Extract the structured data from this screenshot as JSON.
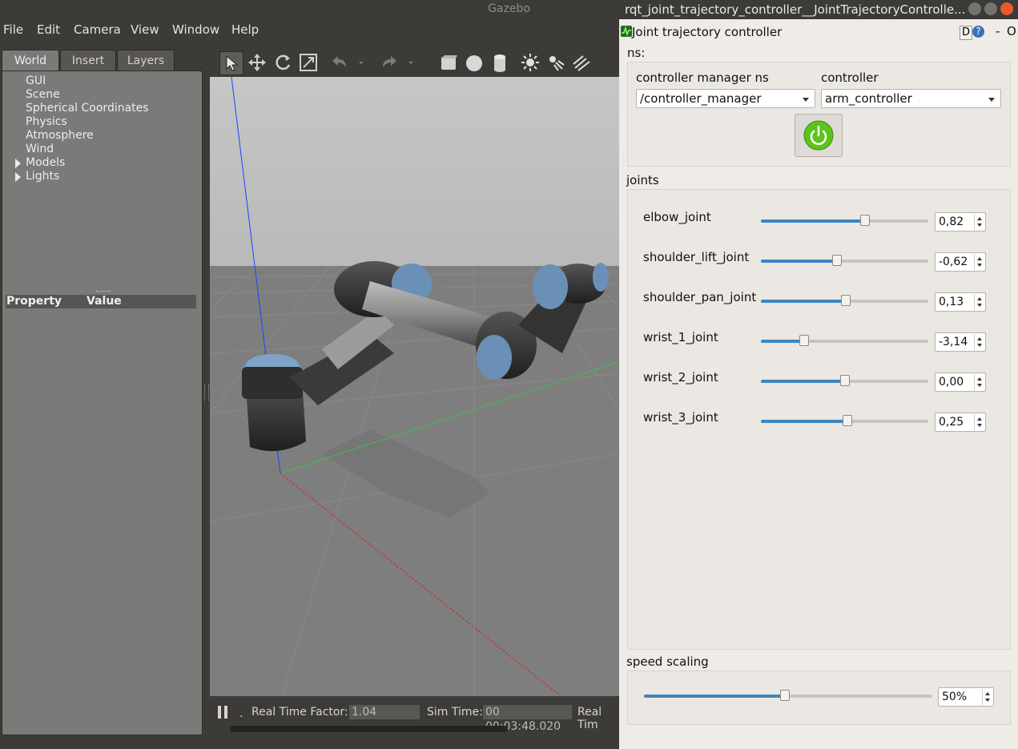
{
  "gazebo": {
    "window_title": "Gazebo",
    "menu": [
      "File",
      "Edit",
      "Camera",
      "View",
      "Window",
      "Help"
    ],
    "tabs": [
      "World",
      "Insert",
      "Layers"
    ],
    "active_tab": "World",
    "tree": {
      "items": [
        "GUI",
        "Scene",
        "Spherical Coordinates",
        "Physics",
        "Atmosphere",
        "Wind"
      ],
      "expandable": [
        "Models",
        "Lights"
      ]
    },
    "properties": {
      "col_property": "Property",
      "col_value": "Value"
    },
    "toolbar_icons": [
      "select-icon",
      "translate-icon",
      "rotate-icon",
      "scale-icon",
      "undo-icon",
      "redo-icon",
      "box-icon",
      "sphere-icon",
      "cylinder-icon",
      "point-light-icon",
      "spot-light-icon",
      "directional-light-icon"
    ],
    "status": {
      "rtf_label": "Real Time Factor:",
      "rtf_value": "1.04",
      "sim_time_label": "Sim Time:",
      "sim_time_value": "00 00:03:48.020",
      "real_time_label": "Real Tim",
      "step_label": "."
    }
  },
  "rqt": {
    "window_title": "rqt_joint_trajectory_controller__JointTrajectoryControlle...",
    "plugin_title": "Joint trajectory controller",
    "header_buttons": {
      "d": "D",
      "help": "?",
      "minus": "-",
      "o": "O"
    },
    "ns_label": "ns:",
    "controller_manager_ns_label": "controller manager ns",
    "controller_label": "controller",
    "controller_manager_ns_value": "/controller_manager",
    "controller_value": "arm_controller",
    "enabled_color": "#5cc41a",
    "joints_label": "joints",
    "joints": [
      {
        "name": "elbow_joint",
        "value": "0,82",
        "slider_fraction": 0.62
      },
      {
        "name": "shoulder_lift_joint",
        "value": "-0,62",
        "slider_fraction": 0.455
      },
      {
        "name": "shoulder_pan_joint",
        "value": "0,13",
        "slider_fraction": 0.505
      },
      {
        "name": "wrist_1_joint",
        "value": "-3,14",
        "slider_fraction": 0.26
      },
      {
        "name": "wrist_2_joint",
        "value": "0,00",
        "slider_fraction": 0.5
      },
      {
        "name": "wrist_3_joint",
        "value": "0,25",
        "slider_fraction": 0.515
      }
    ],
    "speed_scaling_label": "speed scaling",
    "speed_scaling_value": "50%",
    "speed_scaling_fraction": 0.49
  }
}
